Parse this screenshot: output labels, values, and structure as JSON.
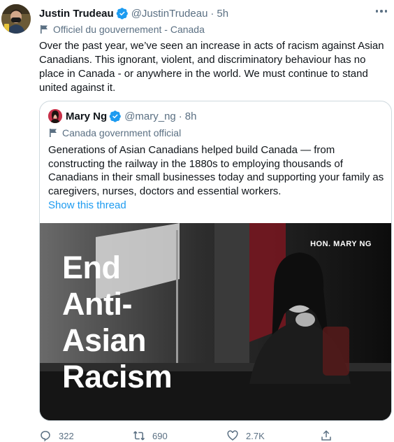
{
  "author": {
    "name": "Justin Trudeau",
    "handle": "@JustinTrudeau",
    "separator": "·",
    "time": "5h",
    "label": "Officiel du gouvernement - Canada"
  },
  "body": "Over the past year, we’ve seen an increase in acts of racism against Asian Canadians. This ignorant, violent, and discriminatory behaviour has no place in Canada - or anywhere in the world. We must continue to stand united against it.",
  "quoted": {
    "name": "Mary Ng",
    "handle": "@mary_ng",
    "separator": "·",
    "time": "8h",
    "label": "Canada government official",
    "text": "Generations of Asian Canadians helped build Canada — from constructing the railway in the 1880s to employing thousands of Canadians in their small businesses today and supporting your family as caregivers, nurses, doctors and essential workers.",
    "link_label": "Show this thread",
    "image": {
      "caption": "HON. MARY NG",
      "headline": [
        "End",
        "Anti-",
        "Asian",
        "Racism"
      ]
    }
  },
  "actions": {
    "replies": "322",
    "retweets": "690",
    "likes": "2.7K"
  },
  "colors": {
    "accent": "#1d9bf0",
    "secondary_text": "#5b7083",
    "border": "#cfd9de"
  }
}
